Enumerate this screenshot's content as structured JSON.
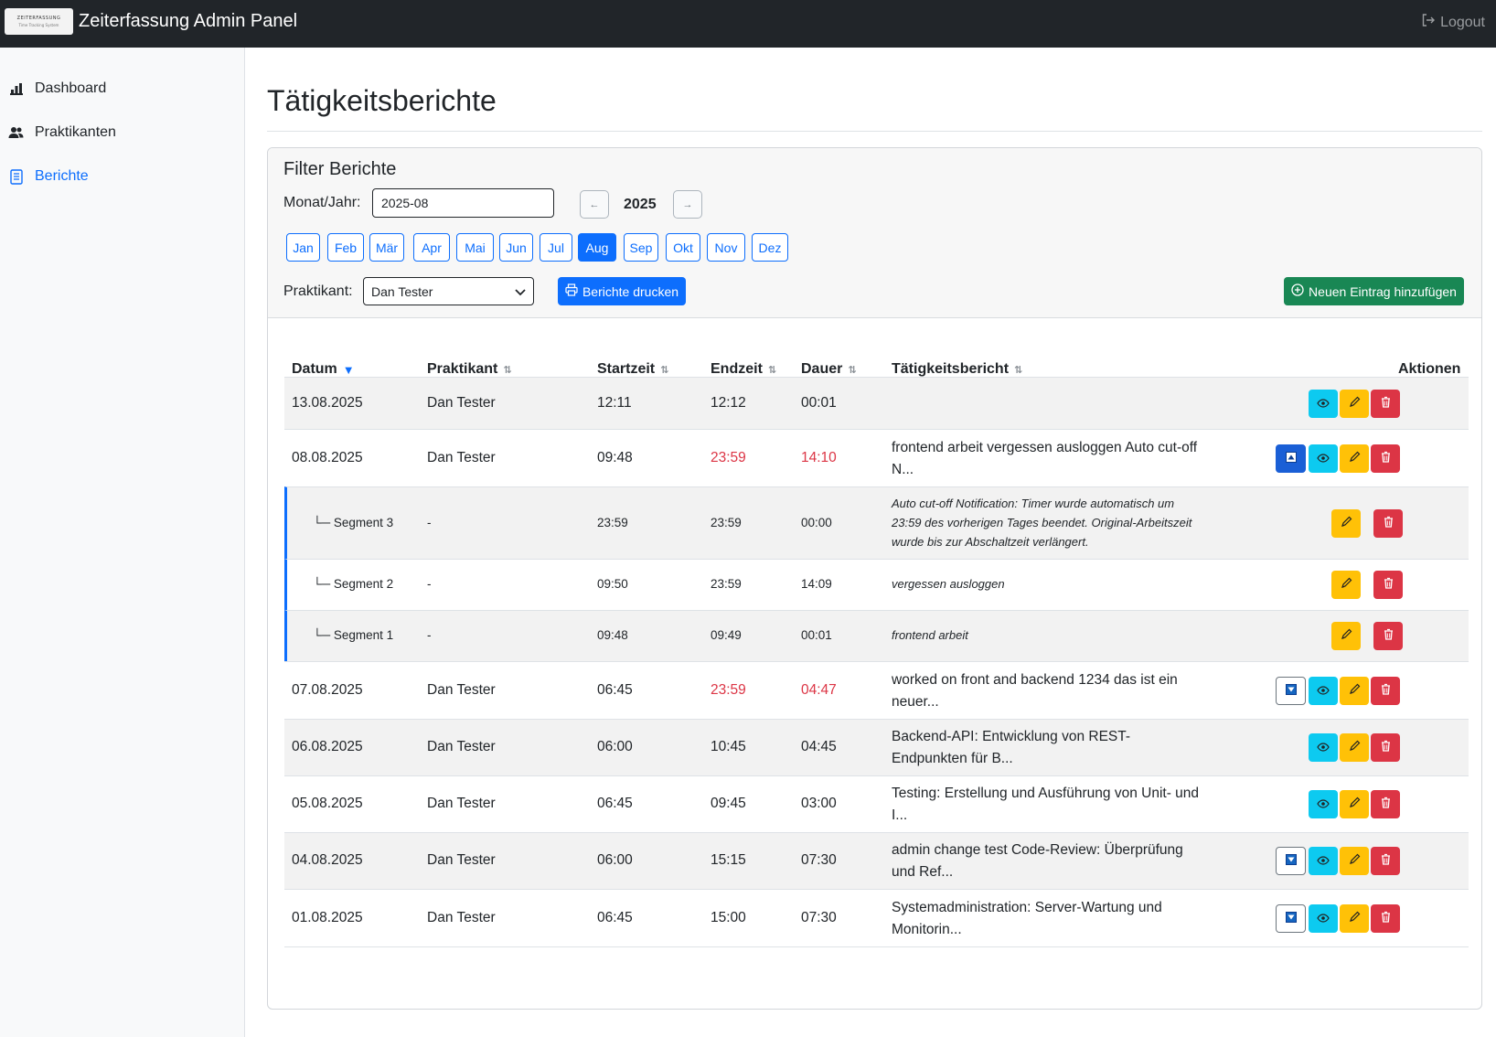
{
  "topbar": {
    "logo_line1": "ZEITERFASSUNG",
    "logo_line2": "Time Tracking System",
    "title": "Zeiterfassung Admin Panel",
    "logout": "Logout"
  },
  "sidebar": {
    "items": [
      {
        "label": "Dashboard",
        "icon": "bar-chart-icon"
      },
      {
        "label": "Praktikanten",
        "icon": "users-icon"
      },
      {
        "label": "Berichte",
        "icon": "document-icon",
        "active": true
      }
    ]
  },
  "page": {
    "title": "Tätigkeitsberichte"
  },
  "filter": {
    "title": "Filter Berichte",
    "month_label": "Monat/Jahr:",
    "month_value": "2025-08",
    "prev": "←",
    "next": "→",
    "year": "2025",
    "months": [
      "Jan",
      "Feb",
      "Mär",
      "Apr",
      "Mai",
      "Jun",
      "Jul",
      "Aug",
      "Sep",
      "Okt",
      "Nov",
      "Dez"
    ],
    "active_month": "Aug",
    "intern_label": "Praktikant:",
    "intern_value": "Dan Tester",
    "print_label": "Berichte drucken",
    "add_label": "Neuen Eintrag hinzufügen"
  },
  "table": {
    "headers": {
      "datum": "Datum",
      "praktikant": "Praktikant",
      "startzeit": "Startzeit",
      "endzeit": "Endzeit",
      "dauer": "Dauer",
      "bericht": "Tätigkeitsbericht",
      "aktionen": "Aktionen"
    },
    "rows": [
      {
        "datum": "13.08.2025",
        "praktikant": "Dan Tester",
        "start": "12:11",
        "end": "12:12",
        "dauer": "00:01",
        "bericht": ""
      },
      {
        "datum": "08.08.2025",
        "praktikant": "Dan Tester",
        "start": "09:48",
        "end": "23:59",
        "dauer": "14:10",
        "bericht": "frontend arbeit vergessen ausloggen Auto cut-off N..."
      },
      {
        "datum": "07.08.2025",
        "praktikant": "Dan Tester",
        "start": "06:45",
        "end": "23:59",
        "dauer": "04:47",
        "bericht": "worked on front and backend 1234 das ist ein neuer..."
      },
      {
        "datum": "06.08.2025",
        "praktikant": "Dan Tester",
        "start": "06:00",
        "end": "10:45",
        "dauer": "04:45",
        "bericht": "Backend-API: Entwicklung von REST-Endpunkten für B..."
      },
      {
        "datum": "05.08.2025",
        "praktikant": "Dan Tester",
        "start": "06:45",
        "end": "09:45",
        "dauer": "03:00",
        "bericht": "Testing: Erstellung und Ausführung von Unit- und I..."
      },
      {
        "datum": "04.08.2025",
        "praktikant": "Dan Tester",
        "start": "06:00",
        "end": "15:15",
        "dauer": "07:30",
        "bericht": "admin change test Code-Review: Überprüfung und Ref..."
      },
      {
        "datum": "01.08.2025",
        "praktikant": "Dan Tester",
        "start": "06:45",
        "end": "15:00",
        "dauer": "07:30",
        "bericht": "Systemadministration: Server-Wartung und Monitorin..."
      }
    ],
    "segments": [
      {
        "label": "└─ Segment 3",
        "praktikant": "-",
        "start": "23:59",
        "end": "23:59",
        "dauer": "00:00",
        "bericht": "Auto cut-off Notification: Timer wurde automatisch um 23:59 des vorherigen Tages beendet. Original-Arbeitszeit wurde bis zur Abschaltzeit verlängert."
      },
      {
        "label": "└─ Segment 2",
        "praktikant": "-",
        "start": "09:50",
        "end": "23:59",
        "dauer": "14:09",
        "bericht": "vergessen ausloggen"
      },
      {
        "label": "└─ Segment 1",
        "praktikant": "-",
        "start": "09:48",
        "end": "09:49",
        "dauer": "00:01",
        "bericht": "frontend arbeit"
      }
    ]
  },
  "colors": {
    "primary": "#0d6efd",
    "success": "#198754",
    "danger": "#dc3545",
    "warning": "#ffc107",
    "info": "#0dcaf0",
    "dark": "#212529"
  }
}
